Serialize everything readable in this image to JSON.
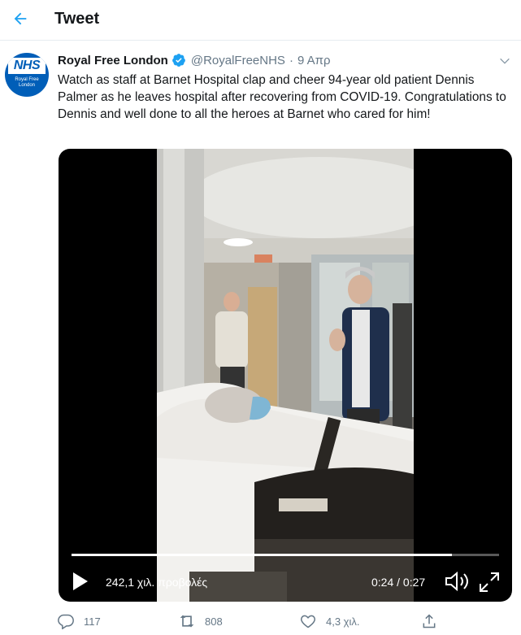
{
  "header": {
    "title": "Tweet",
    "back_icon": "arrow-left-icon"
  },
  "tweet": {
    "author_name": "Royal Free London",
    "handle": "@RoyalFreeNHS",
    "separator": "·",
    "date": "9 Απρ",
    "avatar": {
      "logo_text": "NHS",
      "line1": "Royal Free",
      "line2": "London"
    },
    "text": "Watch as staff at Barnet Hospital clap and cheer 94-year old patient Dennis Palmer as he leaves hospital after recovering from COVID-19. Congratulations to Dennis and well done to all the heroes at Barnet who cared for him!"
  },
  "video": {
    "views": "242,1 χιλ. προβολές",
    "time": "0:24 / 0:27",
    "progress": 0.889
  },
  "actions": {
    "replies": "117",
    "retweets": "808",
    "likes": "4,3 χιλ."
  },
  "colors": {
    "accent": "#1da1f2",
    "secondary_text": "#657786",
    "nhs_blue": "#005eb8"
  }
}
